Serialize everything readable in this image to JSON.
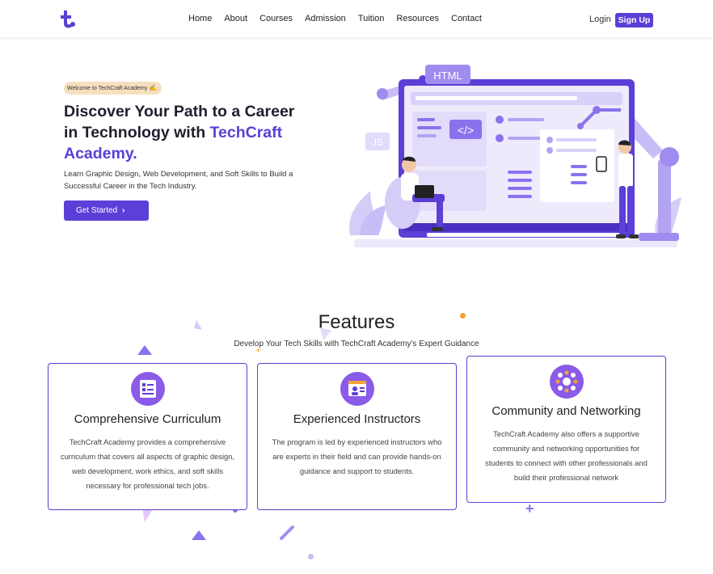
{
  "nav": {
    "links": [
      "Home",
      "About",
      "Courses",
      "Admission",
      "Tuition",
      "Resources",
      "Contact"
    ],
    "login": "Login",
    "signup": "Sign Up"
  },
  "hero": {
    "badge": "Welcome to TechCraft Academy",
    "title_line1": "Discover Your Path to a Career",
    "title_line2_prefix": "in Technology with ",
    "title_accent_1": "TechCraft",
    "title_accent_2": "Academy.",
    "subtitle": "Learn Graphic Design, Web Development, and Soft Skills to Build a Successful Career in the Tech Industry.",
    "cta": "Get Started",
    "illus_html_label": "HTML",
    "illus_js_label": "JS",
    "illus_code_label": "</>"
  },
  "features": {
    "title": "Features",
    "subtitle": "Develop Your Tech Skills with TechCraft Academy's Expert Guidance",
    "cards": [
      {
        "title": "Comprehensive Curriculum",
        "text": "TechCraft Academy provides a comprehensive curriculum that covers all aspects of graphic design, web development, work ethics, and soft skills necessary for professional tech jobs.",
        "icon": "document-checklist-icon"
      },
      {
        "title": "Experienced Instructors",
        "text": "The program is led by experienced instructors who are experts in their field and can provide hands-on guidance and support to students.",
        "icon": "instructor-screen-icon"
      },
      {
        "title": "Community and Networking",
        "text": "TechCraft Academy also offers a supportive community and networking opportunities for students to connect with other professionals and build their professional network",
        "icon": "network-people-icon"
      }
    ]
  },
  "colors": {
    "brand": "#5b3fd6",
    "icon_bg": "#8a5ae8",
    "badge_bg": "#f6dfbf",
    "illus_light": "#c9bdf7"
  }
}
